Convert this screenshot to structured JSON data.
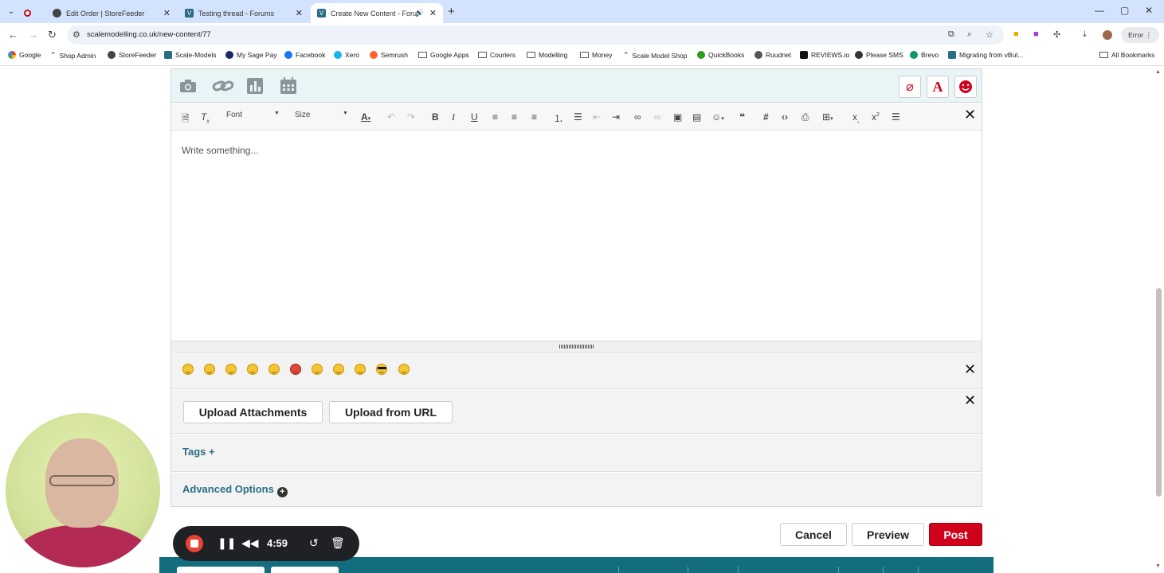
{
  "browser": {
    "tabs": [
      {
        "title": "Edit Order | StoreFeeder"
      },
      {
        "title": "Testing thread - Forums"
      },
      {
        "title": "Create New Content - Foru"
      }
    ],
    "url": "scalemodelling.co.uk/new-content/77",
    "profile_label": "Error",
    "bookmarks": [
      "Google",
      "Shop Admin",
      "StoreFeeder",
      "Scale-Models",
      "My Sage Pay",
      "Facebook",
      "Xero",
      "Semrush",
      "Google Apps",
      "Couriers",
      "Modelling",
      "Money",
      "Scale Model Shop",
      "QuickBooks",
      "Ruudnet",
      "REVIEWS.io",
      "Please SMS",
      "Brevo",
      "Migrating from vBul...",
      "All Bookmarks"
    ]
  },
  "editor": {
    "font_label": "Font",
    "size_label": "Size",
    "placeholder": "Write something...",
    "upload_attachments_label": "Upload Attachments",
    "upload_url_label": "Upload from URL",
    "tags_label": "Tags +",
    "advanced_label": "Advanced Options"
  },
  "actions": {
    "cancel_label": "Cancel",
    "preview_label": "Preview",
    "post_label": "Post"
  },
  "recorder": {
    "time": "4:59"
  },
  "colors": {
    "accent": "#2a6d83",
    "post": "#d0021b",
    "footer": "#146c7f"
  }
}
